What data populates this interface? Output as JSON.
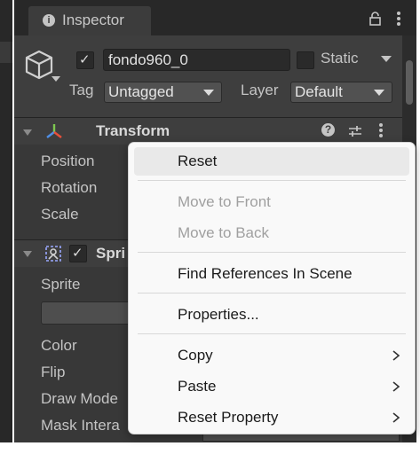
{
  "inspector": {
    "tab_label": "Inspector"
  },
  "object": {
    "name": "fondo960_0",
    "active": true,
    "static_label": "Static",
    "tag_label": "Tag",
    "tag_value": "Untagged",
    "layer_label": "Layer",
    "layer_value": "Default"
  },
  "transform": {
    "title": "Transform",
    "fields": [
      "Position",
      "Rotation",
      "Scale"
    ]
  },
  "sprite_renderer": {
    "title_visible": "Spri",
    "enabled": true,
    "fields": [
      "Sprite",
      "Color",
      "Flip",
      "Draw Mode",
      "Mask Intera"
    ]
  },
  "context_menu": {
    "items": [
      {
        "label": "Reset",
        "enabled": true,
        "hover": true
      },
      {
        "label": "Move to Front",
        "enabled": false
      },
      {
        "label": "Move to Back",
        "enabled": false
      },
      {
        "label": "Find References In Scene",
        "enabled": true
      },
      {
        "label": "Properties...",
        "enabled": true
      },
      {
        "label": "Copy",
        "enabled": true,
        "submenu": true
      },
      {
        "label": "Paste",
        "enabled": true,
        "submenu": true
      },
      {
        "label": "Reset Property",
        "enabled": true,
        "submenu": true
      }
    ]
  },
  "icons": {
    "tab": "info-icon",
    "lock": "lock-icon",
    "more": "more-vertical-icon",
    "object": "cube-icon",
    "transform": "transform-axes-icon",
    "help": "help-icon",
    "preset": "preset-sliders-icon",
    "sprite": "sprite-renderer-icon",
    "submenu": "chevron-right-icon"
  },
  "colors": {
    "panel_bg": "#383838",
    "menu_bg": "#f9f9f9",
    "menu_hover": "#e9e9e9",
    "disabled_text": "#a0a0a0"
  }
}
